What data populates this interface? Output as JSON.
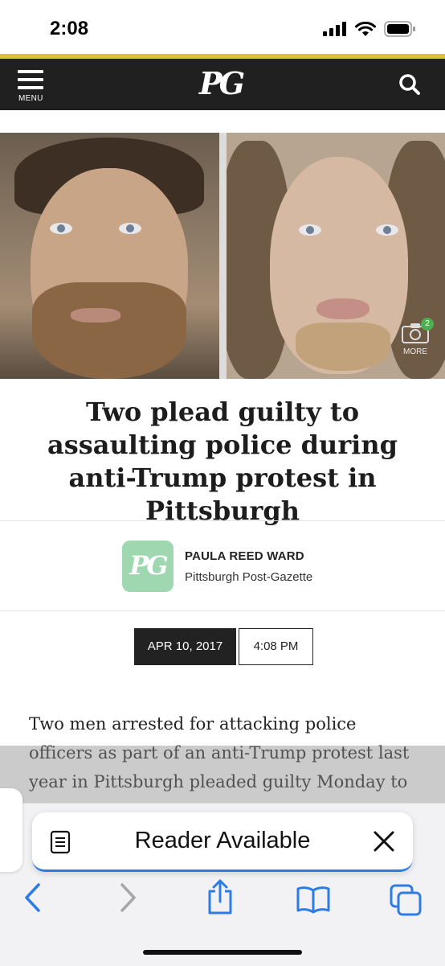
{
  "status_bar": {
    "time": "2:08"
  },
  "header": {
    "menu_label": "MENU",
    "logo_text": "PG"
  },
  "hero": {
    "more_label": "MORE",
    "photo_count": "2"
  },
  "article": {
    "headline": "Two plead guilty to assaulting police during anti-Trump protest in Pittsburgh",
    "author_name": "PAULA REED WARD",
    "author_org": "Pittsburgh Post-Gazette",
    "author_logo_text": "PG",
    "date": "APR 10, 2017",
    "time": "4:08 PM",
    "body": "Two men arrested for attacking police officers as part of an anti-Trump protest last year in Pittsburgh pleaded guilty Monday to"
  },
  "reader_banner": {
    "label": "Reader Available"
  },
  "toolbar": {
    "icons": [
      "back-icon",
      "forward-icon",
      "share-icon",
      "bookmarks-icon",
      "tabs-icon"
    ]
  }
}
